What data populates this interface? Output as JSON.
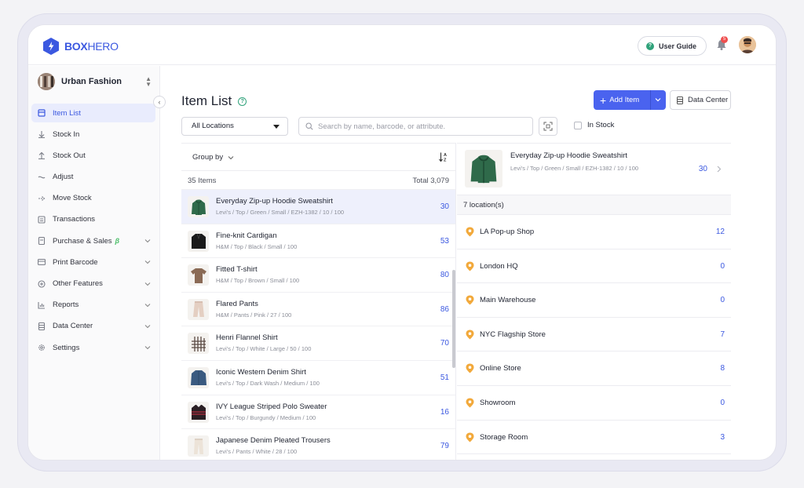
{
  "app": {
    "logo_bold": "BOX",
    "logo_light": "HERO",
    "user_guide_label": "User Guide",
    "notification_count": "5"
  },
  "sidebar": {
    "workspace_name": "Urban Fashion",
    "items": [
      {
        "label": "Item List",
        "icon": "list-icon",
        "active": true
      },
      {
        "label": "Stock In",
        "icon": "arrow-down-icon"
      },
      {
        "label": "Stock Out",
        "icon": "arrow-up-icon"
      },
      {
        "label": "Adjust",
        "icon": "adjust-icon"
      },
      {
        "label": "Move Stock",
        "icon": "arrow-right-icon"
      },
      {
        "label": "Transactions",
        "icon": "transactions-icon"
      },
      {
        "label": "Purchase & Sales",
        "icon": "document-icon",
        "badge": "β",
        "expandable": true
      },
      {
        "label": "Print Barcode",
        "icon": "barcode-icon",
        "expandable": true
      },
      {
        "label": "Other Features",
        "icon": "plus-circle-icon",
        "expandable": true
      },
      {
        "label": "Reports",
        "icon": "chart-icon",
        "expandable": true
      },
      {
        "label": "Data Center",
        "icon": "database-icon",
        "expandable": true
      },
      {
        "label": "Settings",
        "icon": "gear-icon",
        "expandable": true
      }
    ]
  },
  "main": {
    "title": "Item List",
    "add_item_label": "Add Item",
    "data_center_label": "Data Center",
    "location_filter": "All Locations",
    "search_placeholder": "Search by name, barcode, or attribute.",
    "in_stock_label": "In Stock",
    "group_by_label": "Group by",
    "items_count": "35 Items",
    "total_label": "Total 3,079",
    "items": [
      {
        "name": "Everyday Zip-up Hoodie Sweatshirt",
        "attributes": "Levi's / Top / Green / Small / EZH-1382 / 10 / 100",
        "qty": "30",
        "color": "#2f6a4a",
        "selected": true
      },
      {
        "name": "Fine-knit Cardigan",
        "attributes": "H&M / Top / Black / Small / 100",
        "qty": "53",
        "color": "#1a1a1a"
      },
      {
        "name": "Fitted T-shirt",
        "attributes": "H&M / Top / Brown / Small / 100",
        "qty": "80",
        "color": "#8a6a55"
      },
      {
        "name": "Flared Pants",
        "attributes": "H&M / Pants / Pink / 27 / 100",
        "qty": "86",
        "color": "#e4cfc2"
      },
      {
        "name": "Henri Flannel Shirt",
        "attributes": "Levi's / Top / White / Large / 50 / 100",
        "qty": "70",
        "color": "#7a6a64"
      },
      {
        "name": "Iconic Western Denim Shirt",
        "attributes": "Levi's / Top / Dark Wash / Medium / 100",
        "qty": "51",
        "color": "#3a5a80"
      },
      {
        "name": "IVY League Striped Polo Sweater",
        "attributes": "Levi's / Top / Burgundy / Medium / 100",
        "qty": "16",
        "color": "#2a1f24"
      },
      {
        "name": "Japanese Denim Pleated Trousers",
        "attributes": "Levi's / Pants / White / 28 / 100",
        "qty": "79",
        "color": "#ece3d8"
      }
    ]
  },
  "detail": {
    "name": "Everyday Zip-up Hoodie Sweatshirt",
    "attributes": "Levi's / Top / Green / Small / EZH-1382 / 10 / 100",
    "qty": "30",
    "locations_count": "7 location(s)",
    "locations": [
      {
        "name": "LA Pop-up Shop",
        "qty": "12"
      },
      {
        "name": "London HQ",
        "qty": "0"
      },
      {
        "name": "Main Warehouse",
        "qty": "0"
      },
      {
        "name": "NYC Flagship Store",
        "qty": "7"
      },
      {
        "name": "Online Store",
        "qty": "8"
      },
      {
        "name": "Showroom",
        "qty": "0"
      },
      {
        "name": "Storage Room",
        "qty": "3"
      }
    ]
  },
  "colors": {
    "accent": "#4a63ef",
    "brand": "#3b58e0",
    "pin": "#f2a93b",
    "help": "#2fa27a"
  }
}
